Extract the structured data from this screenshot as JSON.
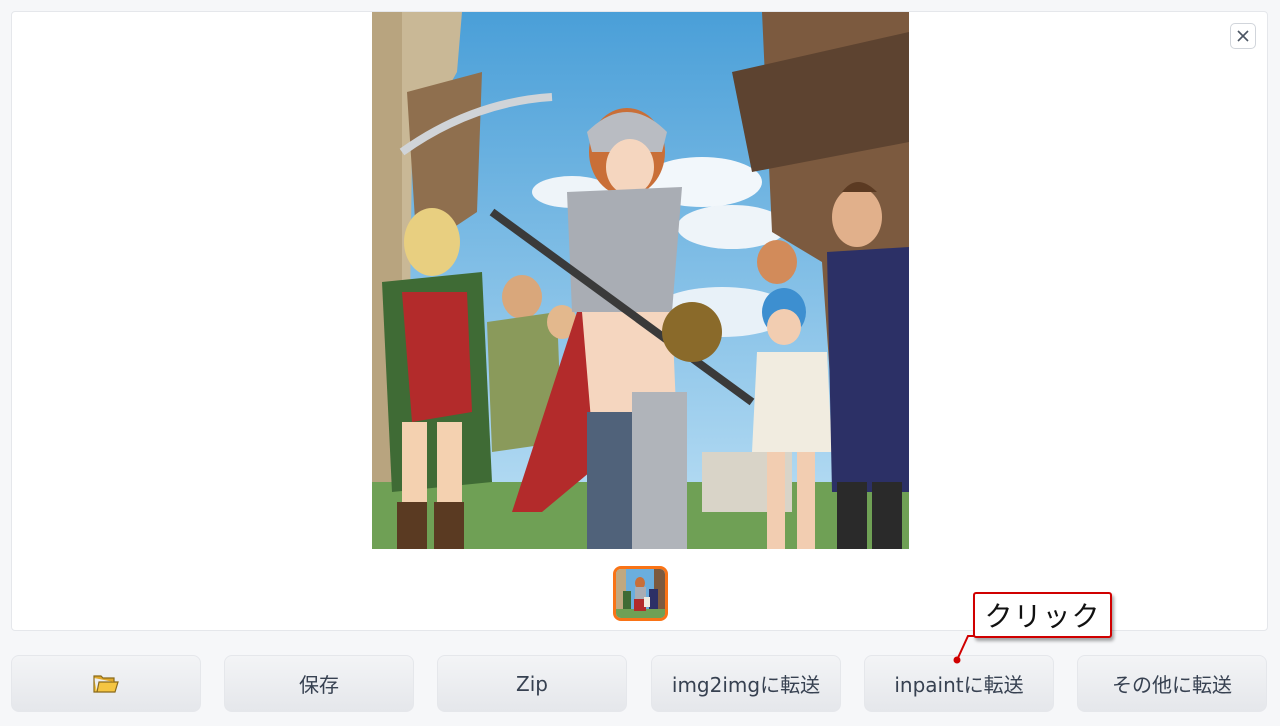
{
  "gallery": {
    "main_image_alt": "anime fantasy knights illustration",
    "close_icon": "close-icon",
    "thumbnail_alt": "thumbnail"
  },
  "buttons": [
    {
      "id": "folder",
      "label": "",
      "icon": "folder-icon"
    },
    {
      "id": "save",
      "label": "保存"
    },
    {
      "id": "zip",
      "label": "Zip"
    },
    {
      "id": "img2img",
      "label": "img2imgに転送"
    },
    {
      "id": "inpaint",
      "label": "inpaintに転送"
    },
    {
      "id": "other",
      "label": "その他に転送"
    }
  ],
  "annotation": {
    "label": "クリック",
    "color": "#d00000"
  },
  "colors": {
    "thumb_border": "#f97316",
    "folder_icon": "#f5c542"
  }
}
